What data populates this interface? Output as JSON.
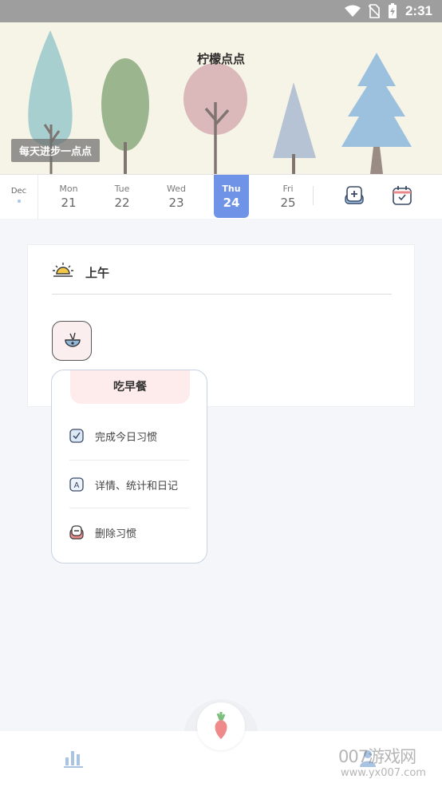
{
  "status_bar": {
    "time": "2:31",
    "icons": [
      "wifi-icon",
      "no-sim-icon",
      "battery-charging-icon"
    ]
  },
  "banner": {
    "title": "柠檬点点",
    "motto": "每天进步一点点"
  },
  "week": {
    "month": "Dec",
    "days": [
      {
        "name": "Mon",
        "num": "21"
      },
      {
        "name": "Tue",
        "num": "22"
      },
      {
        "name": "Wed",
        "num": "23"
      },
      {
        "name": "Thu",
        "num": "24"
      },
      {
        "name": "Fri",
        "num": "25"
      }
    ],
    "selected": "Thu",
    "actions": [
      "add-habit-icon",
      "calendar-icon"
    ],
    "accent_color": "#6f93e6"
  },
  "section": {
    "title": "上午",
    "icon": "sunrise-icon",
    "habit_icon": "noodle-bowl-icon"
  },
  "popup": {
    "title": "吃早餐",
    "items": [
      {
        "label": "完成今日习惯",
        "icon": "check-icon"
      },
      {
        "label": "详情、统计和日记",
        "icon": "details-icon"
      },
      {
        "label": "删除习惯",
        "icon": "delete-icon"
      }
    ]
  },
  "bottom_nav": {
    "left_icon": "stats-icon",
    "center_icon": "radish-icon",
    "right_icon": "profile-icon"
  },
  "watermark": {
    "text": "007游戏网",
    "url": "www.yx007.com"
  }
}
